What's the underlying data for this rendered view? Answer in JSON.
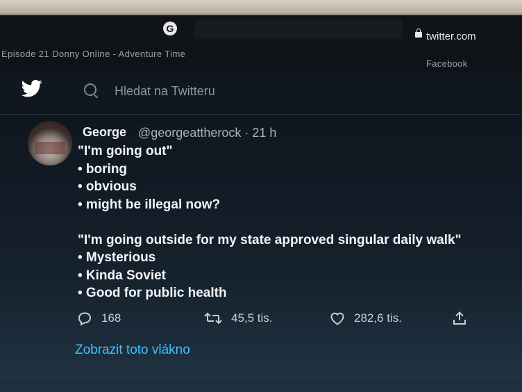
{
  "browser": {
    "url": "twitter.com",
    "bookmarks_left": "Episode 21 Donny Online - Adventure Time",
    "bookmarks_right": "Facebook"
  },
  "header": {
    "search_placeholder": "Hledat na Twitteru"
  },
  "tweet": {
    "author_name": "George",
    "handle_time": "@georgeattherock · 21 h",
    "lines": [
      "\"I'm going out\"",
      "• boring",
      "• obvious",
      "• might be illegal now?",
      "",
      "\"I'm going outside for my state approved singular daily walk\"",
      "• Mysterious",
      "• Kinda Soviet",
      "• Good for public health"
    ],
    "replies": "168",
    "retweets": "45,5 tis.",
    "likes": "282,6 tis.",
    "thread_link": "Zobrazit toto vlákno"
  },
  "colors": {
    "background": "#0c1118",
    "accent": "#3fc2ff",
    "text": "#f2f5f7",
    "muted": "#a7b4bf"
  }
}
